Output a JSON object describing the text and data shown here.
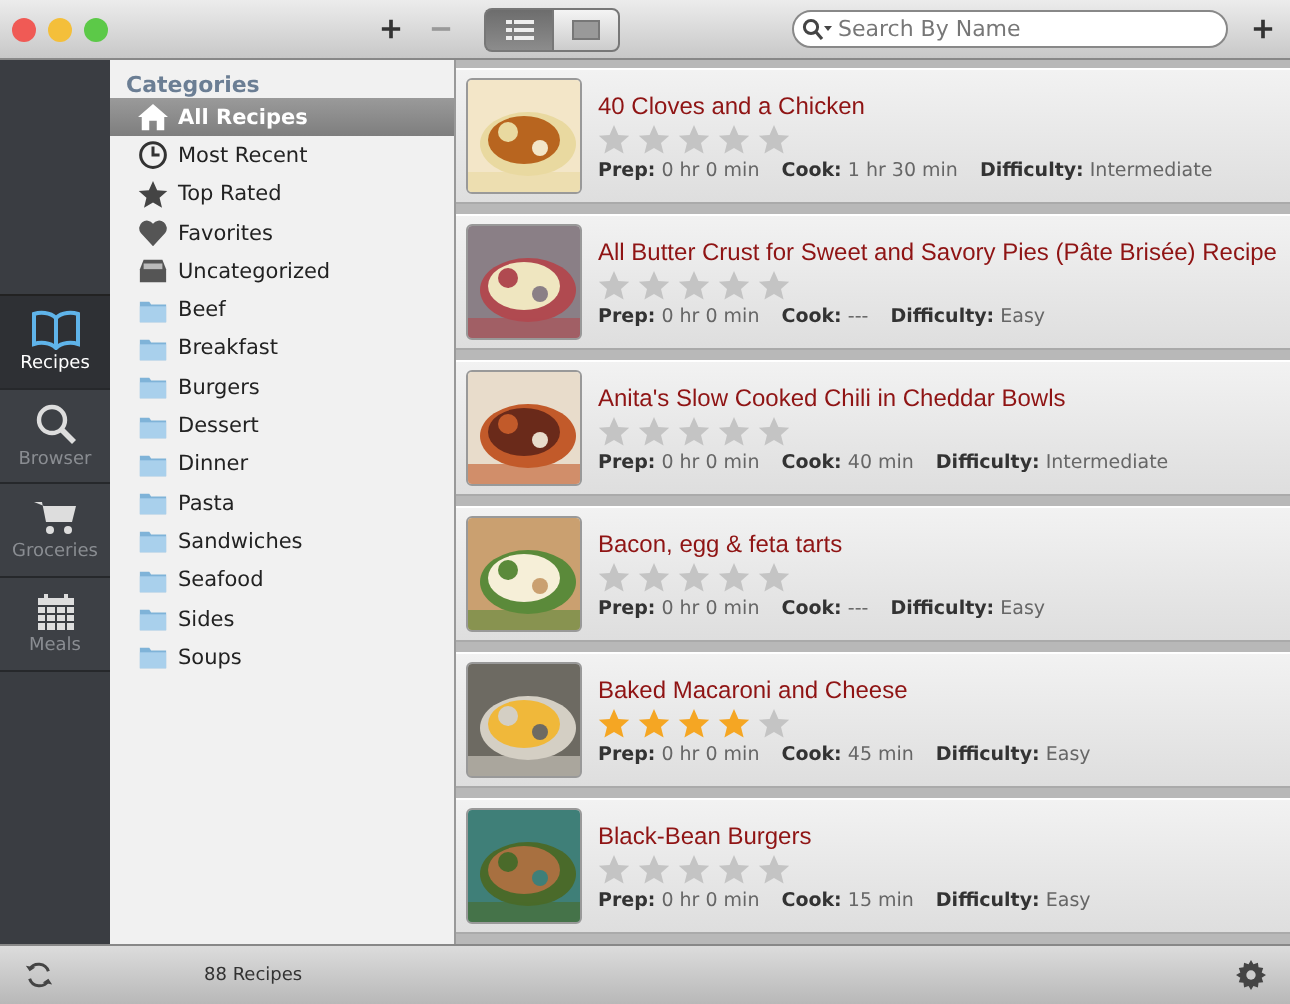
{
  "toolbar": {
    "view_modes": [
      {
        "kind": "list",
        "selected": true
      },
      {
        "kind": "detail",
        "selected": false
      }
    ],
    "search": {
      "placeholder": "Search By Name"
    }
  },
  "rail": [
    {
      "label": "Recipes",
      "kind": "book",
      "selected": true
    },
    {
      "label": "Browser",
      "kind": "search",
      "selected": false
    },
    {
      "label": "Groceries",
      "kind": "cart",
      "selected": false
    },
    {
      "label": "Meals",
      "kind": "calendar",
      "selected": false
    }
  ],
  "categories": {
    "title": "Categories",
    "items": [
      {
        "label": "All Recipes",
        "kind": "home",
        "selected": true
      },
      {
        "label": "Most Recent",
        "kind": "clock",
        "selected": false
      },
      {
        "label": "Top Rated",
        "kind": "star",
        "selected": false
      },
      {
        "label": "Favorites",
        "kind": "heart",
        "selected": false
      },
      {
        "label": "Uncategorized",
        "kind": "tray",
        "selected": false
      },
      {
        "label": "Beef",
        "kind": "folder",
        "selected": false
      },
      {
        "label": "Breakfast",
        "kind": "folder",
        "selected": false
      },
      {
        "label": "Burgers",
        "kind": "folder",
        "selected": false
      },
      {
        "label": "Dessert",
        "kind": "folder",
        "selected": false
      },
      {
        "label": "Dinner",
        "kind": "folder",
        "selected": false
      },
      {
        "label": "Pasta",
        "kind": "folder",
        "selected": false
      },
      {
        "label": "Sandwiches",
        "kind": "folder",
        "selected": false
      },
      {
        "label": "Seafood",
        "kind": "folder",
        "selected": false
      },
      {
        "label": "Sides",
        "kind": "folder",
        "selected": false
      },
      {
        "label": "Soups",
        "kind": "folder",
        "selected": false
      }
    ]
  },
  "recipes": [
    {
      "title": "40 Cloves and a Chicken",
      "stars": 0,
      "details": [
        "**Prep:** 0 hr 0 min",
        "**Cook:** 1 hr 30 min",
        "**Difficulty:** Intermediate"
      ]
    },
    {
      "title": "All Butter Crust for Sweet and Savory Pies (Pâte Brisée) Recipe",
      "stars": 0,
      "details": [
        "**Prep:** 0 hr 0 min",
        "**Cook:** ---",
        "**Difficulty:** Easy"
      ]
    },
    {
      "title": "Anita's Slow Cooked Chili in Cheddar Bowls",
      "stars": 0,
      "details": [
        "**Prep:** 0 hr 0 min",
        "**Cook:** 40 min",
        "**Difficulty:** Intermediate"
      ]
    },
    {
      "title": "Bacon, egg & feta tarts",
      "stars": 0,
      "details": [
        "**Prep:** 0 hr 0 min",
        "**Cook:** ---",
        "**Difficulty:** Easy"
      ]
    },
    {
      "title": "Baked Macaroni and Cheese",
      "stars": 4,
      "details": [
        "**Prep:** 0 hr 0 min",
        "**Cook:** 45 min",
        "**Difficulty:** Easy"
      ]
    },
    {
      "title": "Black-Bean Burgers",
      "stars": 0,
      "details": [
        "**Prep:** 0 hr 0 min",
        "**Cook:** 15 min",
        "**Difficulty:** Easy"
      ]
    }
  ],
  "status_bar": {
    "count": "88 Recipes"
  }
}
